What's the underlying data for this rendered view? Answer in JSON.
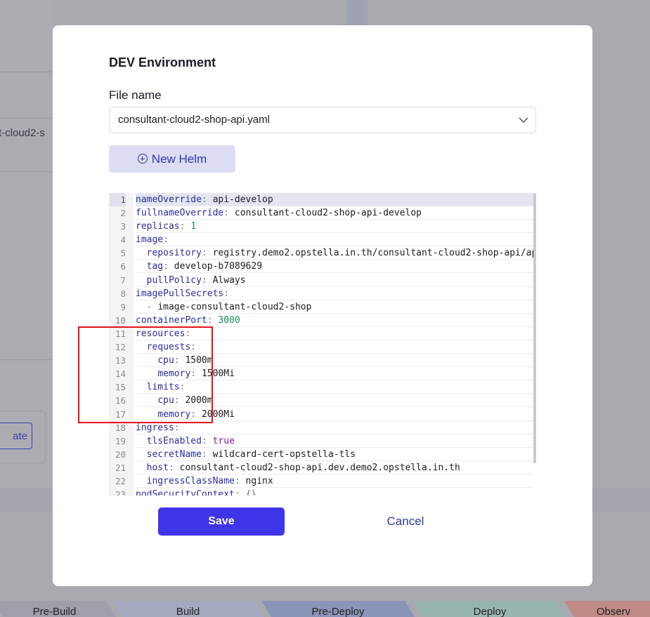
{
  "background": {
    "partial_text": "t-cloud2-s",
    "partial_button": "ate",
    "pipeline_stages": [
      {
        "label": "Pre-Build",
        "color": "#9da0a8"
      },
      {
        "label": "Build",
        "color": "#a4a9c0"
      },
      {
        "label": "Pre-Deploy",
        "color": "#8a94b8"
      },
      {
        "label": "Deploy",
        "color": "#98b4b1"
      },
      {
        "label": "Observ",
        "color": "#c08a86"
      }
    ]
  },
  "modal": {
    "title": "DEV Environment",
    "file_label": "File name",
    "file_value": "consultant-cloud2-shop-api.yaml",
    "new_helm_label": "New Helm",
    "save_label": "Save",
    "cancel_label": "Cancel"
  },
  "editor": {
    "lines": [
      {
        "n": "1",
        "indent": "",
        "key": "nameOverride",
        "value": "api-develop",
        "vtype": "str"
      },
      {
        "n": "2",
        "indent": "",
        "key": "fullnameOverride",
        "value": "consultant-cloud2-shop-api-develop",
        "vtype": "str"
      },
      {
        "n": "3",
        "indent": "",
        "key": "replicas",
        "value": "1",
        "vtype": "num"
      },
      {
        "n": "4",
        "indent": "",
        "key": "image",
        "value": "",
        "vtype": "str"
      },
      {
        "n": "5",
        "indent": "  ",
        "key": "repository",
        "value": "registry.demo2.opstella.in.th/consultant-cloud2-shop-api/ap",
        "vtype": "str"
      },
      {
        "n": "6",
        "indent": "  ",
        "key": "tag",
        "value": "develop-b7089629",
        "vtype": "str"
      },
      {
        "n": "7",
        "indent": "  ",
        "key": "pullPolicy",
        "value": "Always",
        "vtype": "str"
      },
      {
        "n": "8",
        "indent": "",
        "key": "imagePullSecrets",
        "value": "",
        "vtype": "str"
      },
      {
        "n": "9",
        "indent": "  - ",
        "key": "",
        "value": "image-consultant-cloud2-shop",
        "vtype": "str"
      },
      {
        "n": "10",
        "indent": "",
        "key": "containerPort",
        "value": "3000",
        "vtype": "num"
      },
      {
        "n": "11",
        "indent": "",
        "key": "resources",
        "value": "",
        "vtype": "str"
      },
      {
        "n": "12",
        "indent": "  ",
        "key": "requests",
        "value": "",
        "vtype": "str"
      },
      {
        "n": "13",
        "indent": "    ",
        "key": "cpu",
        "value": "1500m",
        "vtype": "str"
      },
      {
        "n": "14",
        "indent": "    ",
        "key": "memory",
        "value": "1500Mi",
        "vtype": "str"
      },
      {
        "n": "15",
        "indent": "  ",
        "key": "limits",
        "value": "",
        "vtype": "str"
      },
      {
        "n": "16",
        "indent": "    ",
        "key": "cpu",
        "value": "2000m",
        "vtype": "str"
      },
      {
        "n": "17",
        "indent": "    ",
        "key": "memory",
        "value": "2000Mi",
        "vtype": "str"
      },
      {
        "n": "18",
        "indent": "",
        "key": "ingress",
        "value": "",
        "vtype": "str"
      },
      {
        "n": "19",
        "indent": "  ",
        "key": "tlsEnabled",
        "value": "true",
        "vtype": "bool"
      },
      {
        "n": "20",
        "indent": "  ",
        "key": "secretName",
        "value": "wildcard-cert-opstella-tls",
        "vtype": "str"
      },
      {
        "n": "21",
        "indent": "  ",
        "key": "host",
        "value": "consultant-cloud2-shop-api.dev.demo2.opstella.in.th",
        "vtype": "str"
      },
      {
        "n": "22",
        "indent": "  ",
        "key": "ingressClassName",
        "value": "nginx",
        "vtype": "str"
      },
      {
        "n": "23",
        "indent": "",
        "key": "podSecurityContext",
        "value": "{}",
        "vtype": "punct"
      }
    ]
  },
  "colors": {
    "accent": "#3f35e8",
    "highlight_border": "#e3131b"
  }
}
